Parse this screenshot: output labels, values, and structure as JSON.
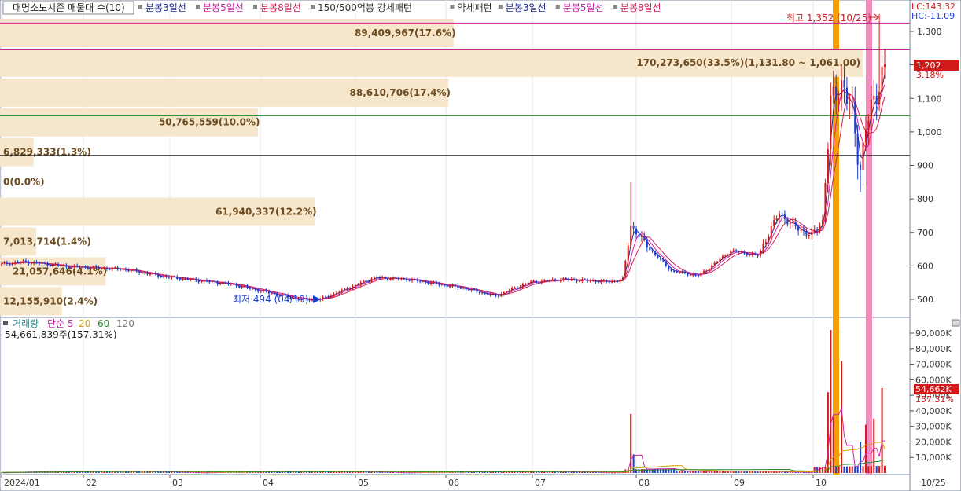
{
  "title_bar": {
    "indicator": "대명소노시즌 매물대 수(10)",
    "items": [
      {
        "text": "분봉3일선",
        "color": "#1f2d8a"
      },
      {
        "text": "분봉5일선",
        "color": "#cc22aa"
      },
      {
        "text": "분봉8일선",
        "color": "#cc2255"
      },
      {
        "text": "150/500억봉 강세패턴",
        "color": "#333333"
      },
      {
        "text": "약세패턴",
        "color": "#333333"
      },
      {
        "text": "분봉3일선",
        "color": "#1f2d8a"
      },
      {
        "text": "분봉5일선",
        "color": "#cc22aa"
      },
      {
        "text": "분봉8일선",
        "color": "#cc2255"
      }
    ]
  },
  "corner": {
    "lc": "LC:143.32",
    "hc": "HC:-11.09"
  },
  "annotations": {
    "high": "최고 1,352 (10/25)",
    "low": "최저 494 (04/19)",
    "last_price": "1,202",
    "last_change": "3.18%"
  },
  "volume_panel": {
    "legend_label": "거래량",
    "legend_ma": [
      {
        "text": "단순 5",
        "color": "#cc22aa"
      },
      {
        "text": "20",
        "color": "#d4a100"
      },
      {
        "text": "60",
        "color": "#2a8a2a"
      },
      {
        "text": "120",
        "color": "#777777"
      }
    ],
    "info": "54,661,839주(157.31%)",
    "last_volume": "54,662K",
    "last_volume_pct": "157.31%"
  },
  "colors": {
    "up": "#d21a1a",
    "down": "#1a3fd2",
    "profile_fill": "#f6e6cc",
    "orange_band": "#f5a00a",
    "pink_band": "#f58cc0"
  },
  "chart_data": [
    {
      "type": "price_candlestick_with_volume_profile",
      "price_axis": {
        "min": 450,
        "max": 1350,
        "ticks": [
          500,
          600,
          700,
          800,
          900,
          1000,
          1100,
          1200,
          1300
        ],
        "tick_labels": [
          "500",
          "600",
          "700",
          "800",
          "900",
          "1,000",
          "1,100",
          "1,200",
          "1,300"
        ]
      },
      "x_axis": {
        "tick_labels": [
          "2024/01",
          "02",
          "03",
          "04",
          "05",
          "06",
          "07",
          "08",
          "09",
          "10",
          "10/25"
        ]
      },
      "horizontal_lines": [
        {
          "price": 1325,
          "color": "#cc2299"
        },
        {
          "price": 1245,
          "color": "#cc2299"
        },
        {
          "price": 1048,
          "color": "#1a8a1a"
        },
        {
          "price": 930,
          "color": "#222222"
        }
      ],
      "volume_profile": [
        {
          "label": "12,155,910(2.4%)",
          "pct": 2.4
        },
        {
          "label": "21,057,646(4.1%)",
          "pct": 4.1
        },
        {
          "label": "7,013,714(1.4%)",
          "pct": 1.4
        },
        {
          "label": "61,940,337(12.2%)",
          "pct": 12.2
        },
        {
          "label": "0(0.0%)",
          "pct": 0.0
        },
        {
          "label": "6,829,333(1.3%)",
          "pct": 1.3
        },
        {
          "label": "50,765,559(10.0%)",
          "pct": 10.0
        },
        {
          "label": "88,610,706(17.4%)",
          "pct": 17.4
        },
        {
          "label": "170,273,650(33.5%)(1,131.80 ~ 1,061.00)",
          "pct": 33.5
        },
        {
          "label": "89,409,967(17.6%)",
          "pct": 17.6
        }
      ],
      "price_waypoints": [
        {
          "i": 0,
          "p": 605
        },
        {
          "i": 8,
          "p": 612
        },
        {
          "i": 25,
          "p": 598
        },
        {
          "i": 45,
          "p": 590
        },
        {
          "i": 60,
          "p": 568
        },
        {
          "i": 85,
          "p": 545
        },
        {
          "i": 110,
          "p": 500
        },
        {
          "i": 118,
          "p": 500
        },
        {
          "i": 138,
          "p": 565
        },
        {
          "i": 150,
          "p": 560
        },
        {
          "i": 170,
          "p": 535
        },
        {
          "i": 183,
          "p": 510
        },
        {
          "i": 195,
          "p": 550
        },
        {
          "i": 208,
          "p": 560
        },
        {
          "i": 225,
          "p": 552
        },
        {
          "i": 230,
          "p": 560
        },
        {
          "i": 233,
          "p": 720
        },
        {
          "i": 240,
          "p": 650
        },
        {
          "i": 248,
          "p": 585
        },
        {
          "i": 258,
          "p": 570
        },
        {
          "i": 270,
          "p": 645
        },
        {
          "i": 280,
          "p": 630
        },
        {
          "i": 288,
          "p": 760
        },
        {
          "i": 292,
          "p": 725
        },
        {
          "i": 300,
          "p": 690
        },
        {
          "i": 304,
          "p": 735
        },
        {
          "i": 307,
          "p": 1080
        },
        {
          "i": 311,
          "p": 1150
        },
        {
          "i": 315,
          "p": 1050
        },
        {
          "i": 318,
          "p": 890
        },
        {
          "i": 320,
          "p": 1010
        },
        {
          "i": 324,
          "p": 1120
        },
        {
          "i": 327,
          "p": 1202
        }
      ],
      "total_bars": 328
    },
    {
      "type": "volume_bar",
      "y_axis": {
        "min": 0,
        "max": 95000,
        "ticks": [
          10000,
          20000,
          30000,
          40000,
          50000,
          60000,
          70000,
          80000,
          90000
        ],
        "tick_labels": [
          "10,000K",
          "20,000K",
          "30,000K",
          "40,000K",
          "50,000K",
          "60,000K",
          "70,000K",
          "80,000K",
          "90,000K"
        ]
      },
      "spikes": [
        {
          "i": 233,
          "v": 38000
        },
        {
          "i": 234,
          "v": 12000
        },
        {
          "i": 306,
          "v": 52000
        },
        {
          "i": 307,
          "v": 92000
        },
        {
          "i": 308,
          "v": 36000
        },
        {
          "i": 311,
          "v": 72000
        },
        {
          "i": 318,
          "v": 20000
        },
        {
          "i": 320,
          "v": 31000
        },
        {
          "i": 323,
          "v": 35000
        },
        {
          "i": 326,
          "v": 54662
        }
      ]
    }
  ]
}
